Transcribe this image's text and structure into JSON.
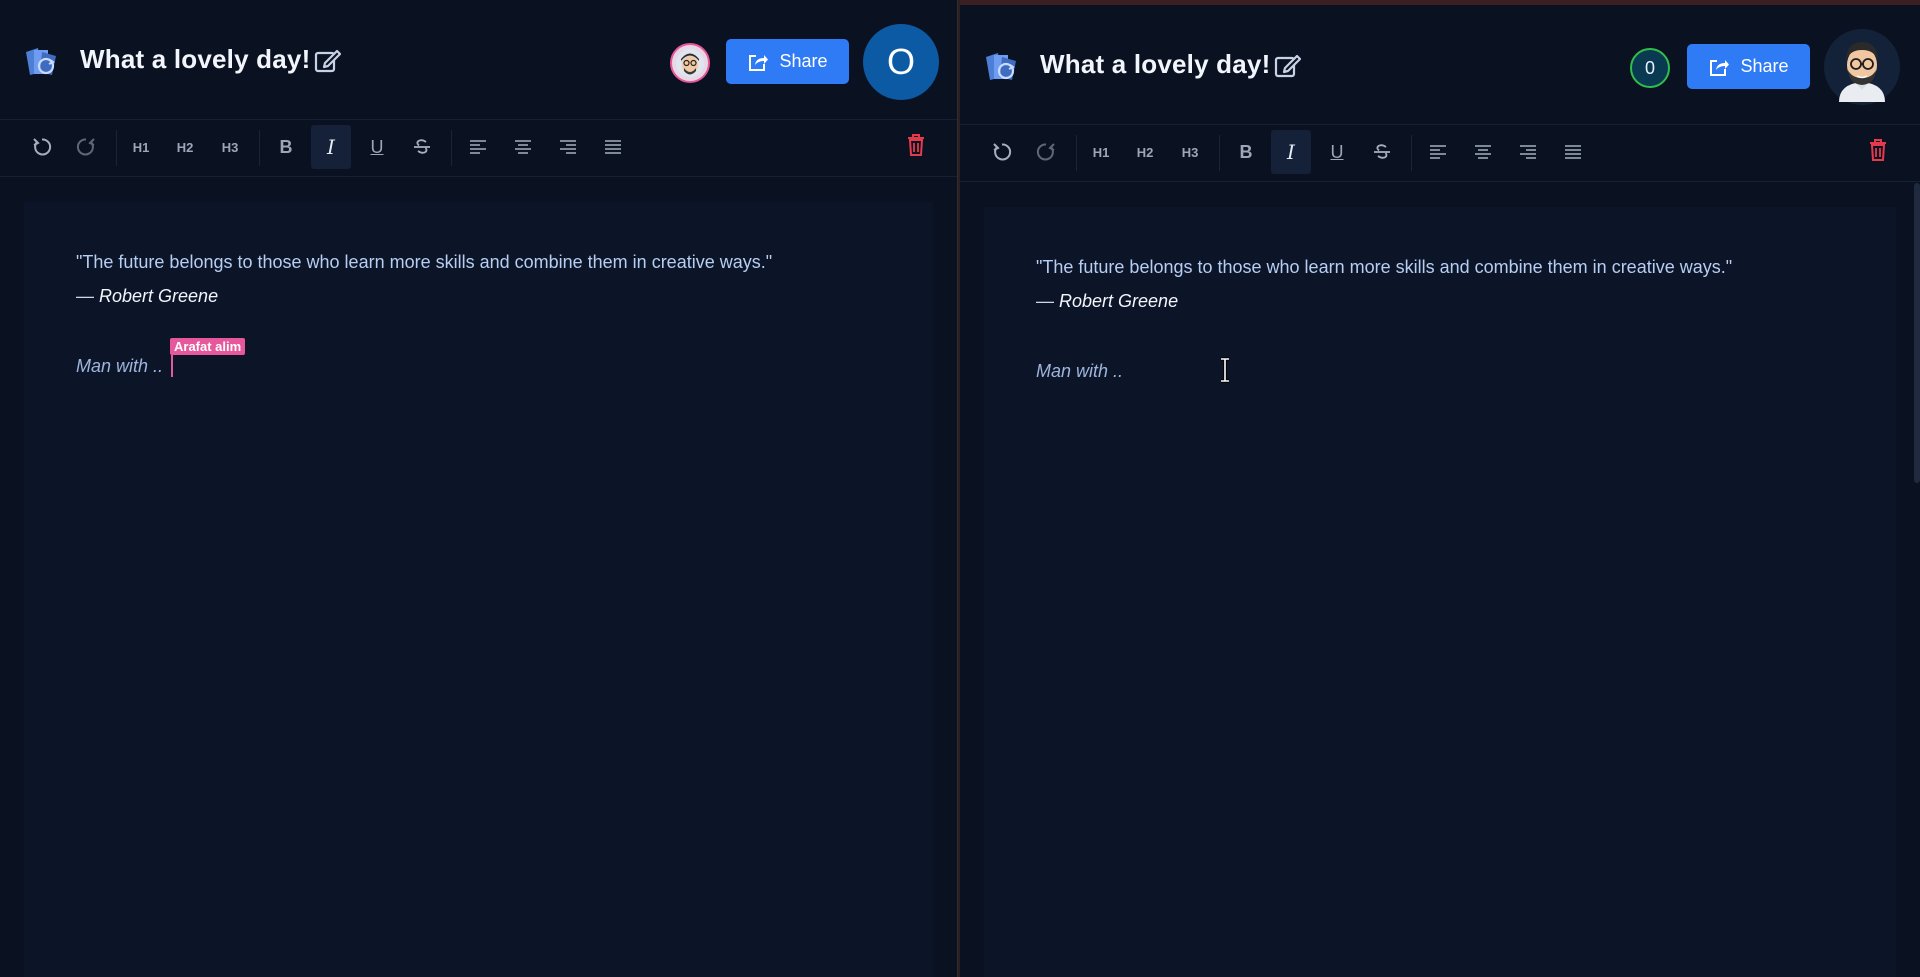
{
  "left": {
    "title": "What a lovely day!",
    "share_label": "Share",
    "user_initial": "O",
    "toolbar": {
      "h1": "H1",
      "h2": "H2",
      "h3": "H3",
      "bold": "B",
      "italic": "I",
      "underline": "U"
    },
    "content": {
      "quote": "\"The future belongs to those who learn more skills and combine them in creative ways.\"",
      "author_dash": "—",
      "author": "Robert Greene",
      "line3": "Man with ..",
      "remote_cursor_name": "Arafat alim"
    }
  },
  "right": {
    "title": "What a lovely day!",
    "share_label": "Share",
    "viewer_count": "0",
    "toolbar": {
      "h1": "H1",
      "h2": "H2",
      "h3": "H3",
      "bold": "B",
      "italic": "I",
      "underline": "U"
    },
    "content": {
      "quote": "\"The future belongs to those who learn more skills and combine them in creative ways.\"",
      "author_dash": "—",
      "author": "Robert Greene",
      "line3": "Man with .."
    }
  },
  "colors": {
    "background": "#0a1120",
    "editor": "#0c1528",
    "accent": "#2f7af5",
    "remote_cursor": "#e6579b",
    "online_ring": "#2fbf4a",
    "delete": "#e5394c",
    "user_circle": "#0b5aa3"
  }
}
